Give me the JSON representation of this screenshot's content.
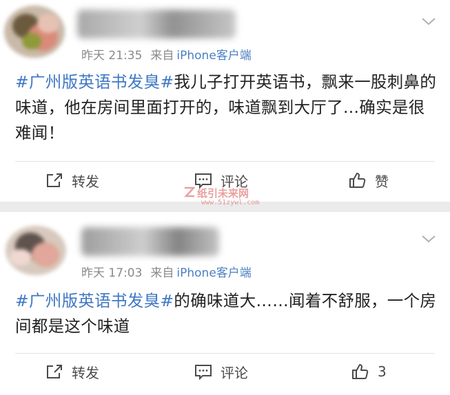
{
  "posts": [
    {
      "time": "昨天 21:35",
      "from_label": "来自",
      "source": "iPhone客户端",
      "hashtag": "#广州版英语书发臭#",
      "body": "我儿子打开英语书，飘来一股刺鼻的味道，他在房间里面打开的，味道飘到大厅了...确实是很难闻！",
      "actions": {
        "repost": "转发",
        "comment": "评论",
        "like": "赞"
      }
    },
    {
      "time": "昨天 17:03",
      "from_label": "来自",
      "source": "iPhone客户端",
      "hashtag": "#广州版英语书发臭#",
      "body": "的确味道大……闻着不舒服，一个房间都是这个味道",
      "actions": {
        "repost": "转发",
        "comment": "评论",
        "like": "3"
      }
    }
  ],
  "watermark": {
    "main": "纸引未来网",
    "sub": "www.51zywl.com"
  },
  "icons": [
    "chevron-down-icon",
    "repost-icon",
    "comment-icon",
    "like-icon"
  ],
  "colors": {
    "link": "#3f78c4",
    "meta": "#8a8a8a",
    "source": "#4a7fc3"
  }
}
